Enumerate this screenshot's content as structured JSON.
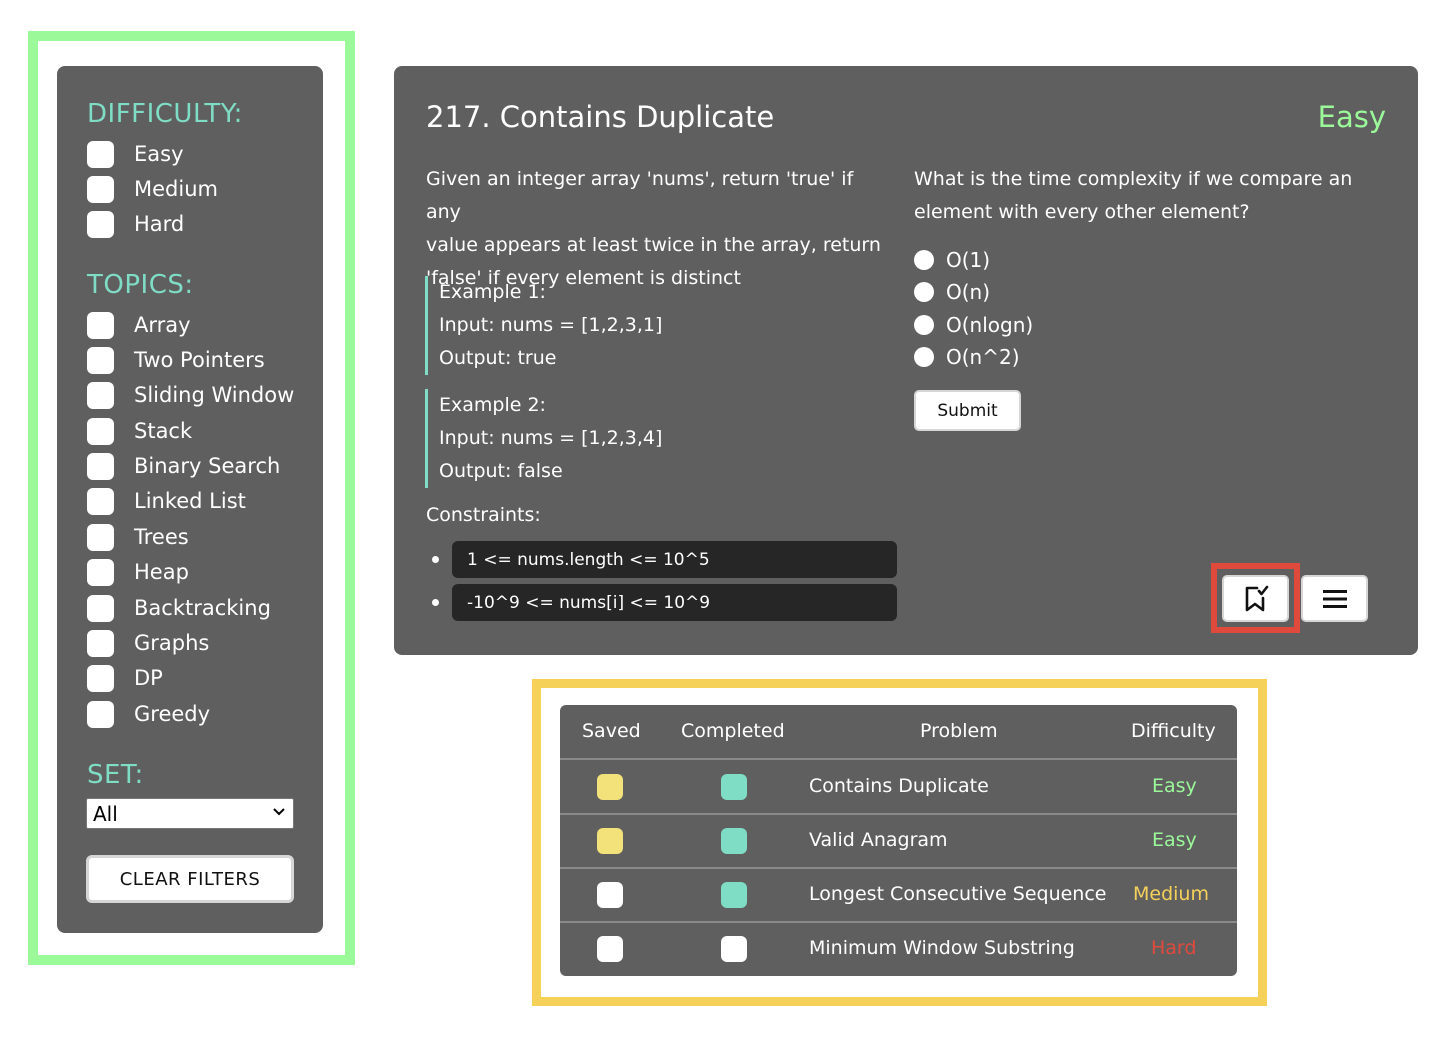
{
  "filters": {
    "difficulty_heading": "DIFFICULTY:",
    "difficulty_options": [
      "Easy",
      "Medium",
      "Hard"
    ],
    "topics_heading": "TOPICS:",
    "topic_options": [
      "Array",
      "Two Pointers",
      "Sliding Window",
      "Stack",
      "Binary Search",
      "Linked List",
      "Trees",
      "Heap",
      "Backtracking",
      "Graphs",
      "DP",
      "Greedy"
    ],
    "set_heading": "SET:",
    "set_selected": "All",
    "clear_label": "CLEAR FILTERS"
  },
  "problem": {
    "title": "217. Contains Duplicate",
    "difficulty": "Easy",
    "description_lines": [
      "Given an integer array 'nums', return 'true' if any",
      "value appears at least twice in the array, return",
      "'false' if every element is distinct"
    ],
    "examples": [
      {
        "label": "Example 1:",
        "input": "Input: nums = [1,2,3,1]",
        "output": "Output: true"
      },
      {
        "label": "Example 2:",
        "input": "Input: nums = [1,2,3,4]",
        "output": "Output: false"
      }
    ],
    "constraints_label": "Constraints:",
    "constraints": [
      "1 <= nums.length <= 10^5",
      "-10^9 <= nums[i] <= 10^9"
    ],
    "question_lines": [
      "What is the time complexity if we compare an",
      "element with every other element?"
    ],
    "answer_options": [
      "O(1)",
      "O(n)",
      "O(nlogn)",
      "O(n^2)"
    ],
    "submit_label": "Submit",
    "icons": [
      "bookmark-check-icon",
      "menu-icon"
    ]
  },
  "table": {
    "headers": [
      "Saved",
      "Completed",
      "Problem",
      "Difficulty"
    ],
    "rows": [
      {
        "saved": true,
        "completed": true,
        "problem": "Contains Duplicate",
        "difficulty": "Easy"
      },
      {
        "saved": true,
        "completed": true,
        "problem": "Valid Anagram",
        "difficulty": "Easy"
      },
      {
        "saved": false,
        "completed": true,
        "problem": "Longest Consecutive Sequence",
        "difficulty": "Medium"
      },
      {
        "saved": false,
        "completed": false,
        "problem": "Minimum Window Substring",
        "difficulty": "Hard"
      }
    ]
  },
  "colors": {
    "accent_teal": "#7fdcc5",
    "easy": "#9cf99a",
    "medium": "#f5d15a",
    "hard": "#e04a3c",
    "saved_fill": "#f3e27a",
    "completed_fill": "#7fdcc5",
    "panel_bg": "#5f5f5f",
    "highlight_green": "#9cf99a",
    "highlight_yellow": "#f5d15a",
    "highlight_red": "#e04a3c"
  }
}
